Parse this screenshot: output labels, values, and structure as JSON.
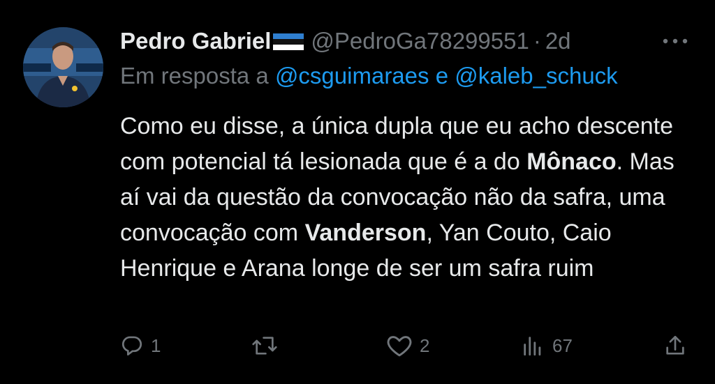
{
  "author": {
    "name": "Pedro Gabriel",
    "flag_icon": "estonia-flag-icon",
    "handle": "@PedroGa78299551",
    "separator": "·",
    "time": "2d"
  },
  "reply": {
    "prefix": "Em resposta a",
    "mention1": "@csguimaraes",
    "conjunction": "e",
    "mention2": "@kaleb_schuck"
  },
  "tweet": {
    "t1": "Como eu disse, a única dupla que eu acho descente com potencial tá lesionada que é a do ",
    "b1": "Mônaco",
    "t2": ". Mas aí vai da questão da convocação não da safra, uma convocação com ",
    "b2": "Vanderson",
    "t3": ", Yan Couto, Caio Henrique e Arana longe de ser um safra ruim"
  },
  "actions": {
    "replies": "1",
    "retweets": "",
    "likes": "2",
    "views": "67"
  },
  "colors": {
    "background": "#000000",
    "text": "#e7e9ea",
    "secondary": "#71767b",
    "accent": "#1d9bf0"
  }
}
